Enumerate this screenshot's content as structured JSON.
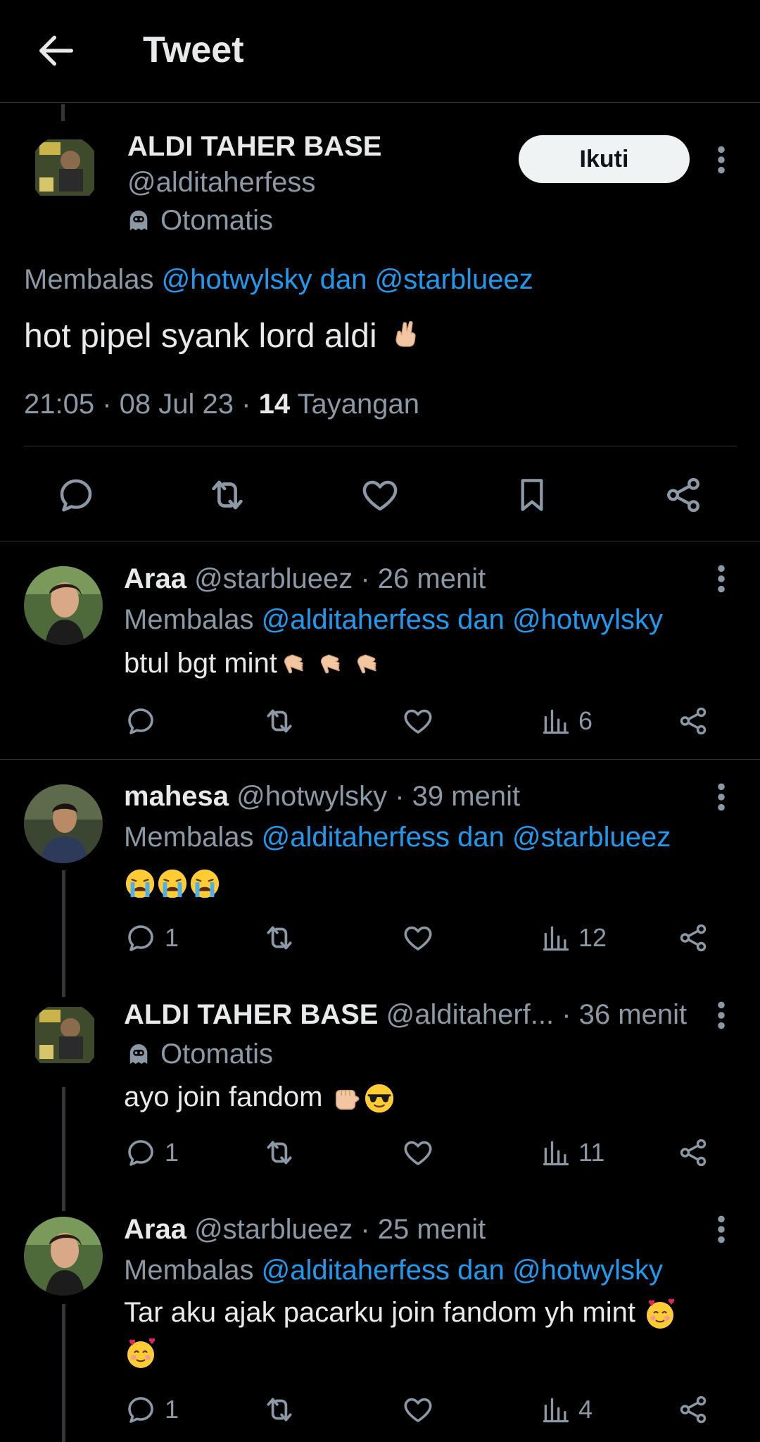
{
  "header": {
    "title": "Tweet"
  },
  "main_tweet": {
    "display_name": "ALDI TAHER BASE",
    "handle": "@alditaherfess",
    "automated_label": "Otomatis",
    "follow_label": "Ikuti",
    "replying_prefix": "Membalas",
    "replying_to_1": "@hotwylsky",
    "replying_and": "dan",
    "replying_to_2": "@starblueez",
    "text": "hot pipel syank lord aldi",
    "time": "21:05",
    "date": "08 Jul 23",
    "views_count": "14",
    "views_label": "Tayangan"
  },
  "replies": [
    {
      "display_name": "Araa",
      "handle": "@starblueez",
      "time": "26 menit",
      "replying_prefix": "Membalas",
      "replying_to_1": "@alditaherfess",
      "replying_and": "dan",
      "replying_to_2": "@hotwylsky",
      "text": "btul bgt mint",
      "reply_count": "",
      "views": "6"
    },
    {
      "display_name": "mahesa",
      "handle": "@hotwylsky",
      "time": "39 menit",
      "replying_prefix": "Membalas",
      "replying_to_1": "@alditaherfess",
      "replying_and": "dan",
      "replying_to_2": "@starblueez",
      "text": "",
      "reply_count": "1",
      "views": "12"
    },
    {
      "display_name": "ALDI TAHER BASE",
      "handle": "@alditaherf...",
      "time": "36 menit",
      "automated_label": "Otomatis",
      "text": "ayo join fandom",
      "reply_count": "1",
      "views": "11"
    },
    {
      "display_name": "Araa",
      "handle": "@starblueez",
      "time": "25 menit",
      "replying_prefix": "Membalas",
      "replying_to_1": "@alditaherfess",
      "replying_and": "dan",
      "replying_to_2": "@hotwylsky",
      "text": "Tar aku ajak pacarku join fandom yh mint",
      "reply_count": "1",
      "views": "4"
    }
  ],
  "icons": {
    "back": "arrow-left-icon",
    "reply": "reply-icon",
    "retweet": "retweet-icon",
    "like": "heart-icon",
    "bookmark": "bookmark-icon",
    "share": "share-icon",
    "views": "views-chart-icon",
    "more": "more-vertical-icon",
    "bot": "bot-icon"
  },
  "colors": {
    "background": "#000000",
    "text": "#e7e9ea",
    "muted": "#8b98a5",
    "link": "#1d9bf0",
    "button": "#eff3f4"
  }
}
